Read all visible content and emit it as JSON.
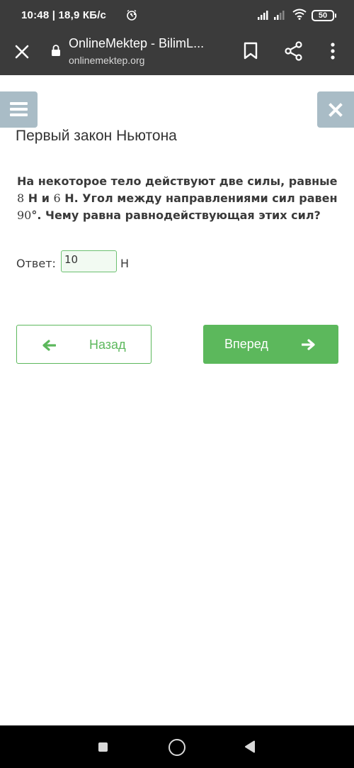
{
  "status_bar": {
    "time_speed": "10:48 | 18,9 КБ/с",
    "extra": "··",
    "battery": "50"
  },
  "browser": {
    "page_title": "OnlineMektep - BilimL...",
    "url": "onlinemektep.org"
  },
  "page": {
    "lesson_title": "Первый закон Ньютона",
    "question": {
      "part1": "На некоторое тело действуют две силы, равные ",
      "f1": "8",
      "part2": " Н и ",
      "f2": "6",
      "part3": " Н. Угол между направлениями сил равен ",
      "angle": "90",
      "part4": "°. Чему равна равнодействующая этих сил?"
    },
    "answer": {
      "label": "Ответ:",
      "value": "10",
      "unit": "Н"
    },
    "buttons": {
      "back": "Назад",
      "next": "Вперед"
    }
  },
  "colors": {
    "accent_green": "#5cb85c",
    "side_button": "#a9bcc6",
    "bar_dark": "#3b3b3b"
  },
  "icons": [
    "alarm-icon",
    "signal-icon",
    "wifi-icon",
    "battery-icon",
    "close-icon",
    "lock-icon",
    "bookmark-icon",
    "share-icon",
    "more-vert-icon",
    "hamburger-icon",
    "close-lesson-icon",
    "arrow-left-icon",
    "arrow-right-icon",
    "recents-icon",
    "home-icon",
    "back-icon"
  ]
}
